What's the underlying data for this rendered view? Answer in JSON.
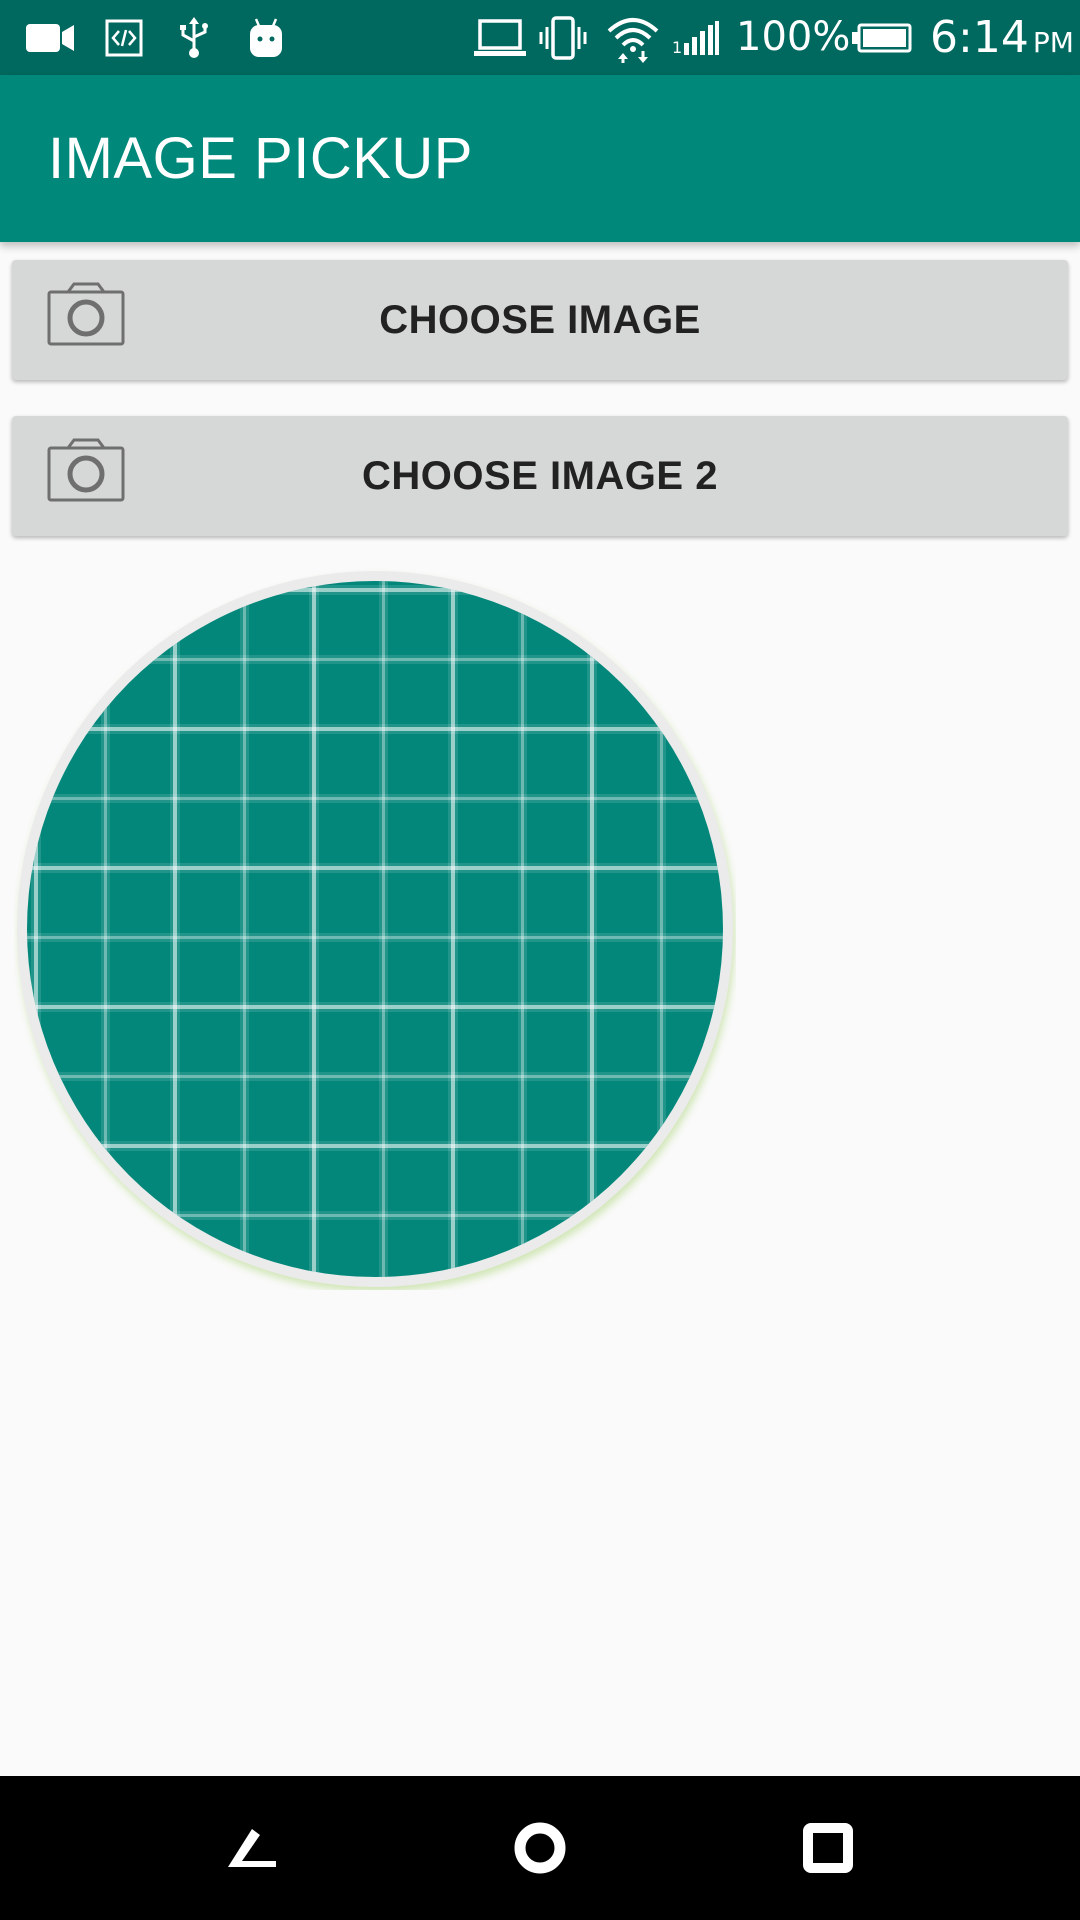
{
  "status_bar": {
    "icons": [
      "video-camera-icon",
      "code-icon",
      "usb-icon",
      "android-debug-icon",
      "laptop-icon",
      "vibrate-icon",
      "wifi-icon",
      "cell-signal-icon",
      "battery-icon"
    ],
    "battery_percent": "100%",
    "time": "6:14",
    "ampm": "PM"
  },
  "toolbar": {
    "title": "IMAGE PICKUP",
    "color": "#00897b"
  },
  "buttons": [
    {
      "label": "CHOOSE IMAGE",
      "icon": "camera-icon"
    },
    {
      "label": "CHOOSE IMAGE 2",
      "icon": "camera-icon"
    }
  ],
  "preview": {
    "icon": "grid-image-placeholder",
    "fill_color": "#03877a",
    "border_color": "#ebebeb"
  },
  "nav_bar": {
    "icons": [
      "back-icon",
      "home-icon",
      "recents-icon"
    ]
  }
}
